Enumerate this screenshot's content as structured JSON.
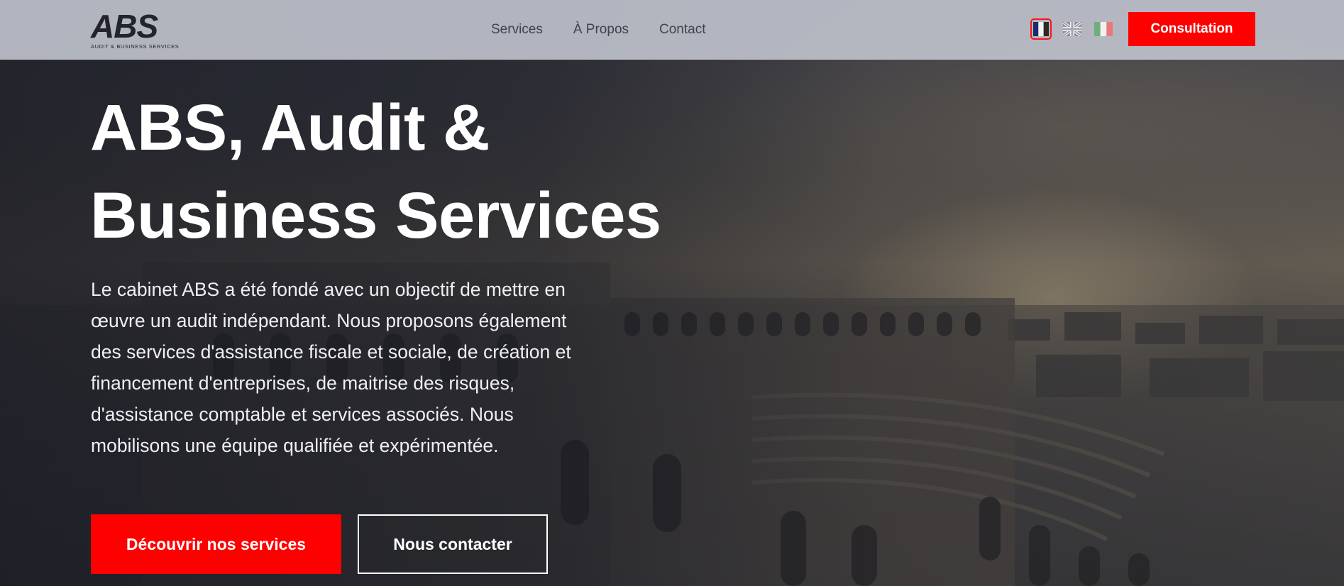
{
  "logo": {
    "mark": "ABS",
    "subtitle": "AUDIT & BUSINESS SERVICES"
  },
  "nav": {
    "items": [
      {
        "label": "Services"
      },
      {
        "label": "À Propos"
      },
      {
        "label": "Contact"
      }
    ]
  },
  "languages": {
    "selected": "fr",
    "options": [
      {
        "code": "fr",
        "icon": "france-flag-icon"
      },
      {
        "code": "en",
        "icon": "uk-flag-icon"
      },
      {
        "code": "it",
        "icon": "italy-flag-icon"
      }
    ]
  },
  "header_cta": "Consultation",
  "hero": {
    "title_line1": "ABS, Audit &",
    "title_line2": "Business Services",
    "lead_lines": [
      "Le cabinet ABS a été fondé avec un objectif de mettre en",
      "œuvre un audit indépendant. Nous proposons également",
      "des services d'assistance fiscale et sociale, de création et",
      "financement d'entreprises, de maitrise des risques,",
      "d'assistance comptable et services associés. Nous",
      "mobilisons une équipe qualifiée et expérimentée."
    ],
    "primary_button": "Découvrir nos services",
    "secondary_button": "Nous contacter"
  },
  "colors": {
    "accent": "#ff0000",
    "header_bg": "#bec1cb",
    "hero_text": "#ffffff",
    "nav_text": "#3f4250"
  }
}
